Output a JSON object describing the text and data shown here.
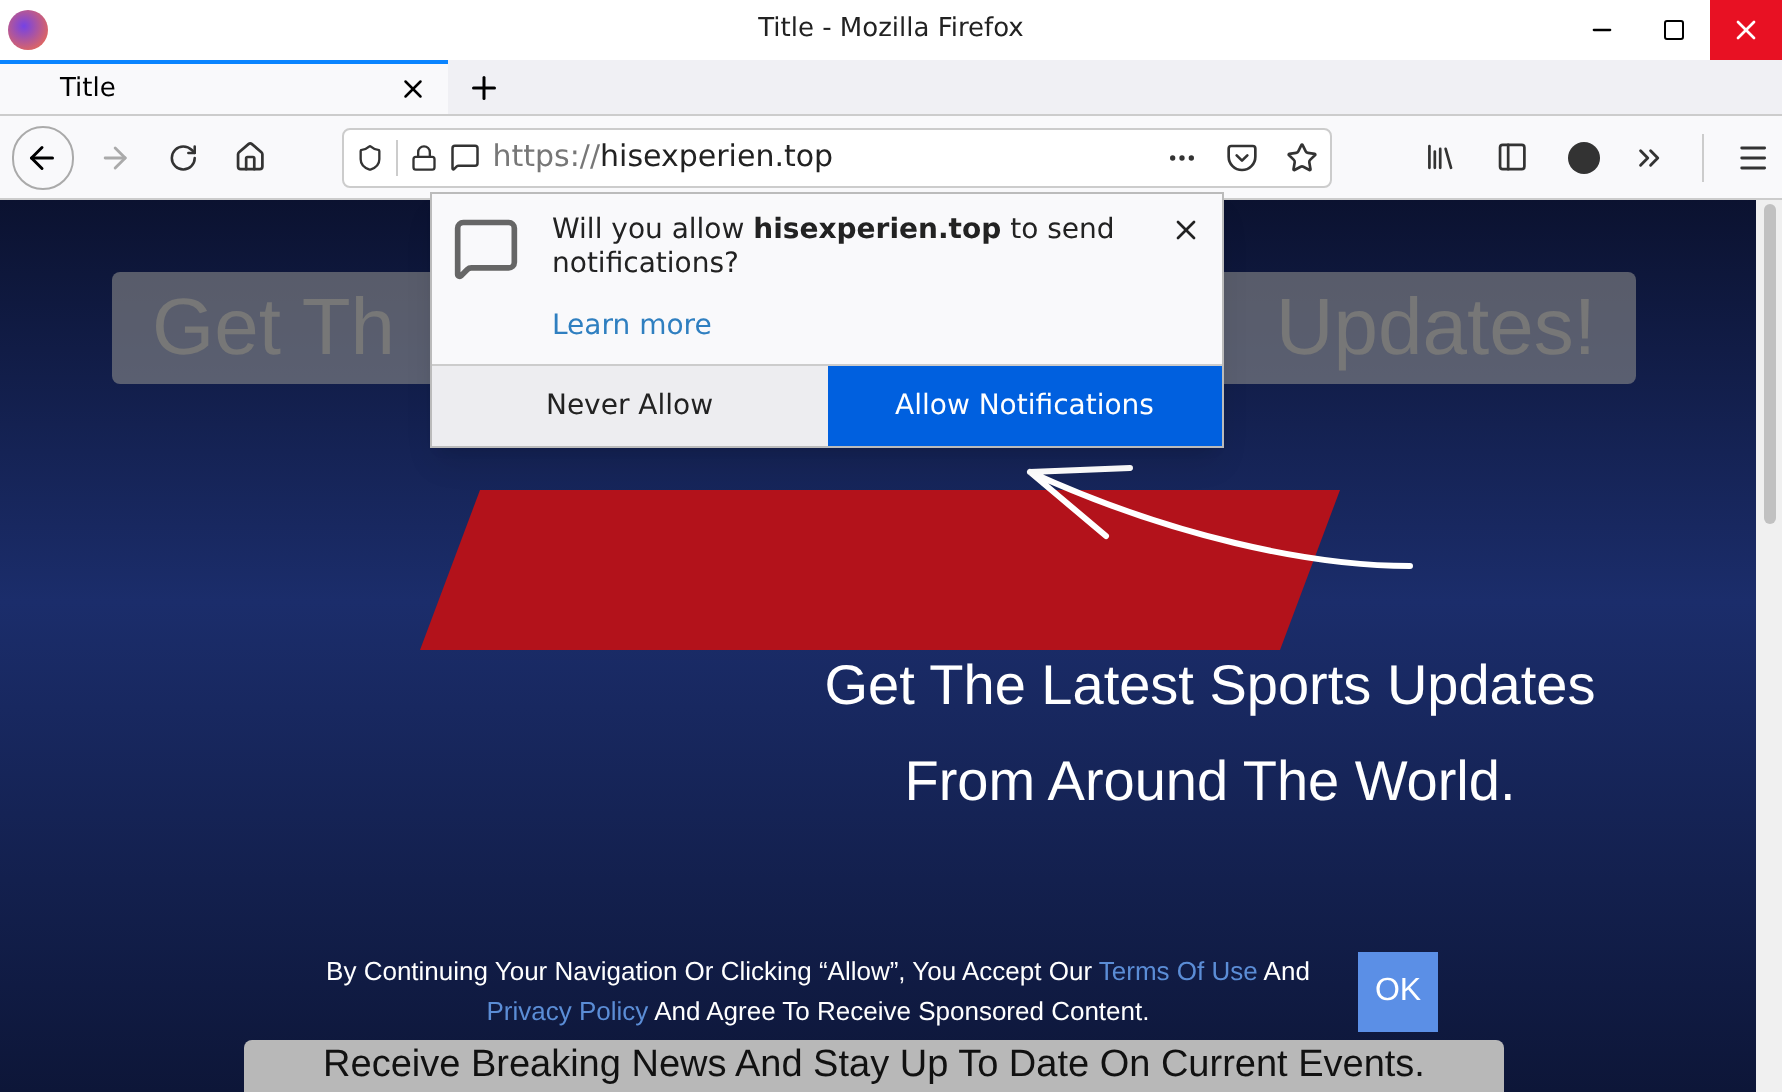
{
  "window": {
    "title": "Title - Mozilla Firefox"
  },
  "tabs": [
    {
      "label": "Title",
      "selected": true
    }
  ],
  "address_bar": {
    "scheme": "https://",
    "host": "hisexperien.top"
  },
  "notification_popup": {
    "message": "Will you allow **hisexperien.top** to send notifications?",
    "link": "Learn more",
    "buttons": [
      {
        "label": "Never Allow",
        "kind": "secondary"
      },
      {
        "label": "Allow Notifications",
        "kind": "primary"
      }
    ]
  },
  "page": {
    "heading_left": "Get Th",
    "heading_right": "Updates!",
    "tagline": [
      "Get The Latest Sports Updates",
      "From Around The World."
    ],
    "consent": {
      "parts": [
        {
          "kind": "text",
          "text": "By Continuing Your Navigation Or Clicking “Allow”, You Accept Our"
        },
        {
          "kind": "link",
          "text": "Terms Of Use"
        },
        {
          "kind": "text",
          "text": "And"
        },
        {
          "kind": "link",
          "text": "Privacy Policy"
        },
        {
          "kind": "text",
          "text": "And Agree To Receive Sponsored Content."
        }
      ],
      "button": "OK"
    },
    "footer_banner": "Receive Breaking News And Stay Up To Date On Current Events."
  }
}
